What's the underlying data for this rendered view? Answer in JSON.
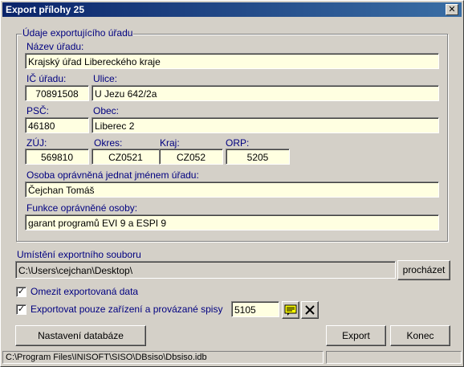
{
  "window": {
    "title": "Export přílohy 25",
    "close_glyph": "✕"
  },
  "group": {
    "title": "Údaje exportujícího úřadu"
  },
  "labels": {
    "nazev": "Název úřadu:",
    "ic": "IČ úřadu:",
    "ulice": "Ulice:",
    "psc": "PSČ:",
    "obec": "Obec:",
    "zuj": "ZÚJ:",
    "okres": "Okres:",
    "kraj": "Kraj:",
    "orp": "ORP:",
    "osoba": "Osoba oprávněná jednat jménem úřadu:",
    "funkce": "Funkce oprávněné osoby:",
    "umisteni": "Umístění exportního souboru"
  },
  "values": {
    "nazev": "Krajský úřad Libereckého kraje",
    "ic": "70891508",
    "ulice": "U Jezu 642/2a",
    "psc": "46180",
    "obec": "Liberec 2",
    "zuj": "569810",
    "okres": "CZ0521",
    "kraj": "CZ052",
    "orp": "5205",
    "osoba": "Čejchan Tomáš",
    "funkce": "garant programů EVI 9 a  ESPI 9",
    "path": "C:\\Users\\cejchan\\Desktop\\",
    "filter_value": "5105"
  },
  "buttons": {
    "prochazet": "procházet",
    "nastaveni": "Nastavení databáze",
    "export": "Export",
    "konec": "Konec"
  },
  "checkboxes": {
    "omezit": {
      "label": "Omezit exportovaná data",
      "checked": true,
      "mark": "✓"
    },
    "pouze": {
      "label": "Exportovat pouze zařízení a provázané spisy",
      "checked": true,
      "mark": "✓"
    }
  },
  "icons": {
    "note": "note-icon",
    "clear": "clear-icon"
  },
  "statusbar": {
    "path": "C:\\Program Files\\INISOFT\\SISO\\DBsiso\\Dbsiso.idb",
    "right": ""
  },
  "colors": {
    "label": "#000080",
    "field_bg": "#ffffe1",
    "title_start": "#0a246a",
    "title_end": "#3a6ea5"
  }
}
